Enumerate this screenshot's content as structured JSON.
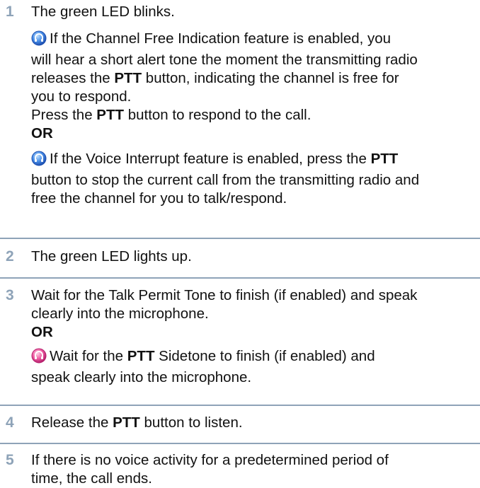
{
  "steps": [
    {
      "num": "1",
      "title": "The green LED blinks.",
      "n1_a": "If the Channel Free Indication feature is enabled, you",
      "n1_b": "will hear a short alert tone the moment the transmitting radio",
      "n1_c1": "releases the ",
      "n1_c2": "PTT",
      "n1_c3": " button, indicating the channel is free for",
      "n1_d": "you to respond.",
      "p1": "Press the ",
      "p2": "PTT",
      "p3": " button to respond to the call.",
      "or": "OR",
      "n2_a1": "If the Voice Interrupt feature is enabled, press the ",
      "n2_a2": "PTT",
      "n2_b": "button to stop the current call from the transmitting radio and",
      "n2_c": "free the channel for you to talk/respond."
    },
    {
      "num": "2",
      "title": "The green LED lights up."
    },
    {
      "num": "3",
      "l1": "Wait for the Talk Permit Tone to finish (if enabled) and speak",
      "l2": "clearly into the microphone.",
      "or": "OR",
      "n_a1": "Wait for the ",
      "n_a2": "PTT",
      "n_a3": " Sidetone to finish (if enabled) and",
      "n_b": "speak clearly into the microphone."
    },
    {
      "num": "4",
      "t1": "Release the ",
      "t2": "PTT",
      "t3": " button to listen."
    },
    {
      "num": "5",
      "l1": "If there is no voice activity for a predetermined period of",
      "l2": "time, the call ends."
    }
  ],
  "icons": {
    "digital": "digital-mode-icon",
    "analog": "analog-mode-icon"
  },
  "colors": {
    "number": "#8ea3b8",
    "divider": "#8ea3b8",
    "digital_icon": "#2f6fd6",
    "analog_icon": "#e0408e"
  }
}
